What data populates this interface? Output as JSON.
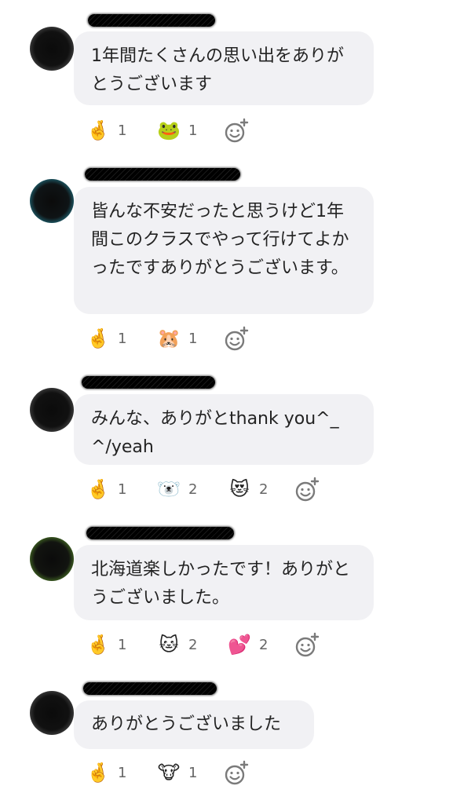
{
  "messages": [
    {
      "text": "1年間たくさんの思い出をありがとうございます",
      "reactions": [
        {
          "emoji": "🤞",
          "count": "1",
          "icon": "crossed-fingers-icon"
        },
        {
          "emoji": "🐸",
          "count": "1",
          "icon": "frog-face-icon"
        }
      ]
    },
    {
      "text": "皆んな不安だったと思うけど1年間このクラスでやって行けてよかったですありがとうございます。",
      "reactions": [
        {
          "emoji": "🤞",
          "count": "1",
          "icon": "crossed-fingers-icon"
        },
        {
          "emoji": "🐹",
          "count": "1",
          "icon": "hamster-face-icon"
        }
      ]
    },
    {
      "text": "みんな、ありがとthank you^_^/yeah",
      "reactions": [
        {
          "emoji": "🤞",
          "count": "1",
          "icon": "crossed-fingers-icon"
        },
        {
          "emoji": "🐻‍❄️",
          "count": "2",
          "icon": "polar-bear-icon"
        },
        {
          "emoji": "😻",
          "count": "2",
          "icon": "heart-eyes-cat-icon"
        }
      ]
    },
    {
      "text": "北海道楽しかったです！ありがとうございました。",
      "reactions": [
        {
          "emoji": "🤞",
          "count": "1",
          "icon": "crossed-fingers-icon"
        },
        {
          "emoji": "🐱",
          "count": "2",
          "icon": "cat-face-icon"
        },
        {
          "emoji": "💕",
          "count": "2",
          "icon": "two-hearts-icon"
        }
      ]
    },
    {
      "text": "ありがとうございました",
      "reactions": [
        {
          "emoji": "🤞",
          "count": "1",
          "icon": "crossed-fingers-icon"
        },
        {
          "emoji": "🐮",
          "count": "1",
          "icon": "cow-face-icon"
        }
      ]
    }
  ],
  "colors": {
    "bubble_bg": "#f1f1f4",
    "text": "#232323",
    "count_text": "#666666",
    "add_icon": "#7a7a7a"
  },
  "icons": {
    "add_reaction": "add-reaction-icon",
    "avatar": "avatar",
    "name_redacted": "redacted-name"
  }
}
